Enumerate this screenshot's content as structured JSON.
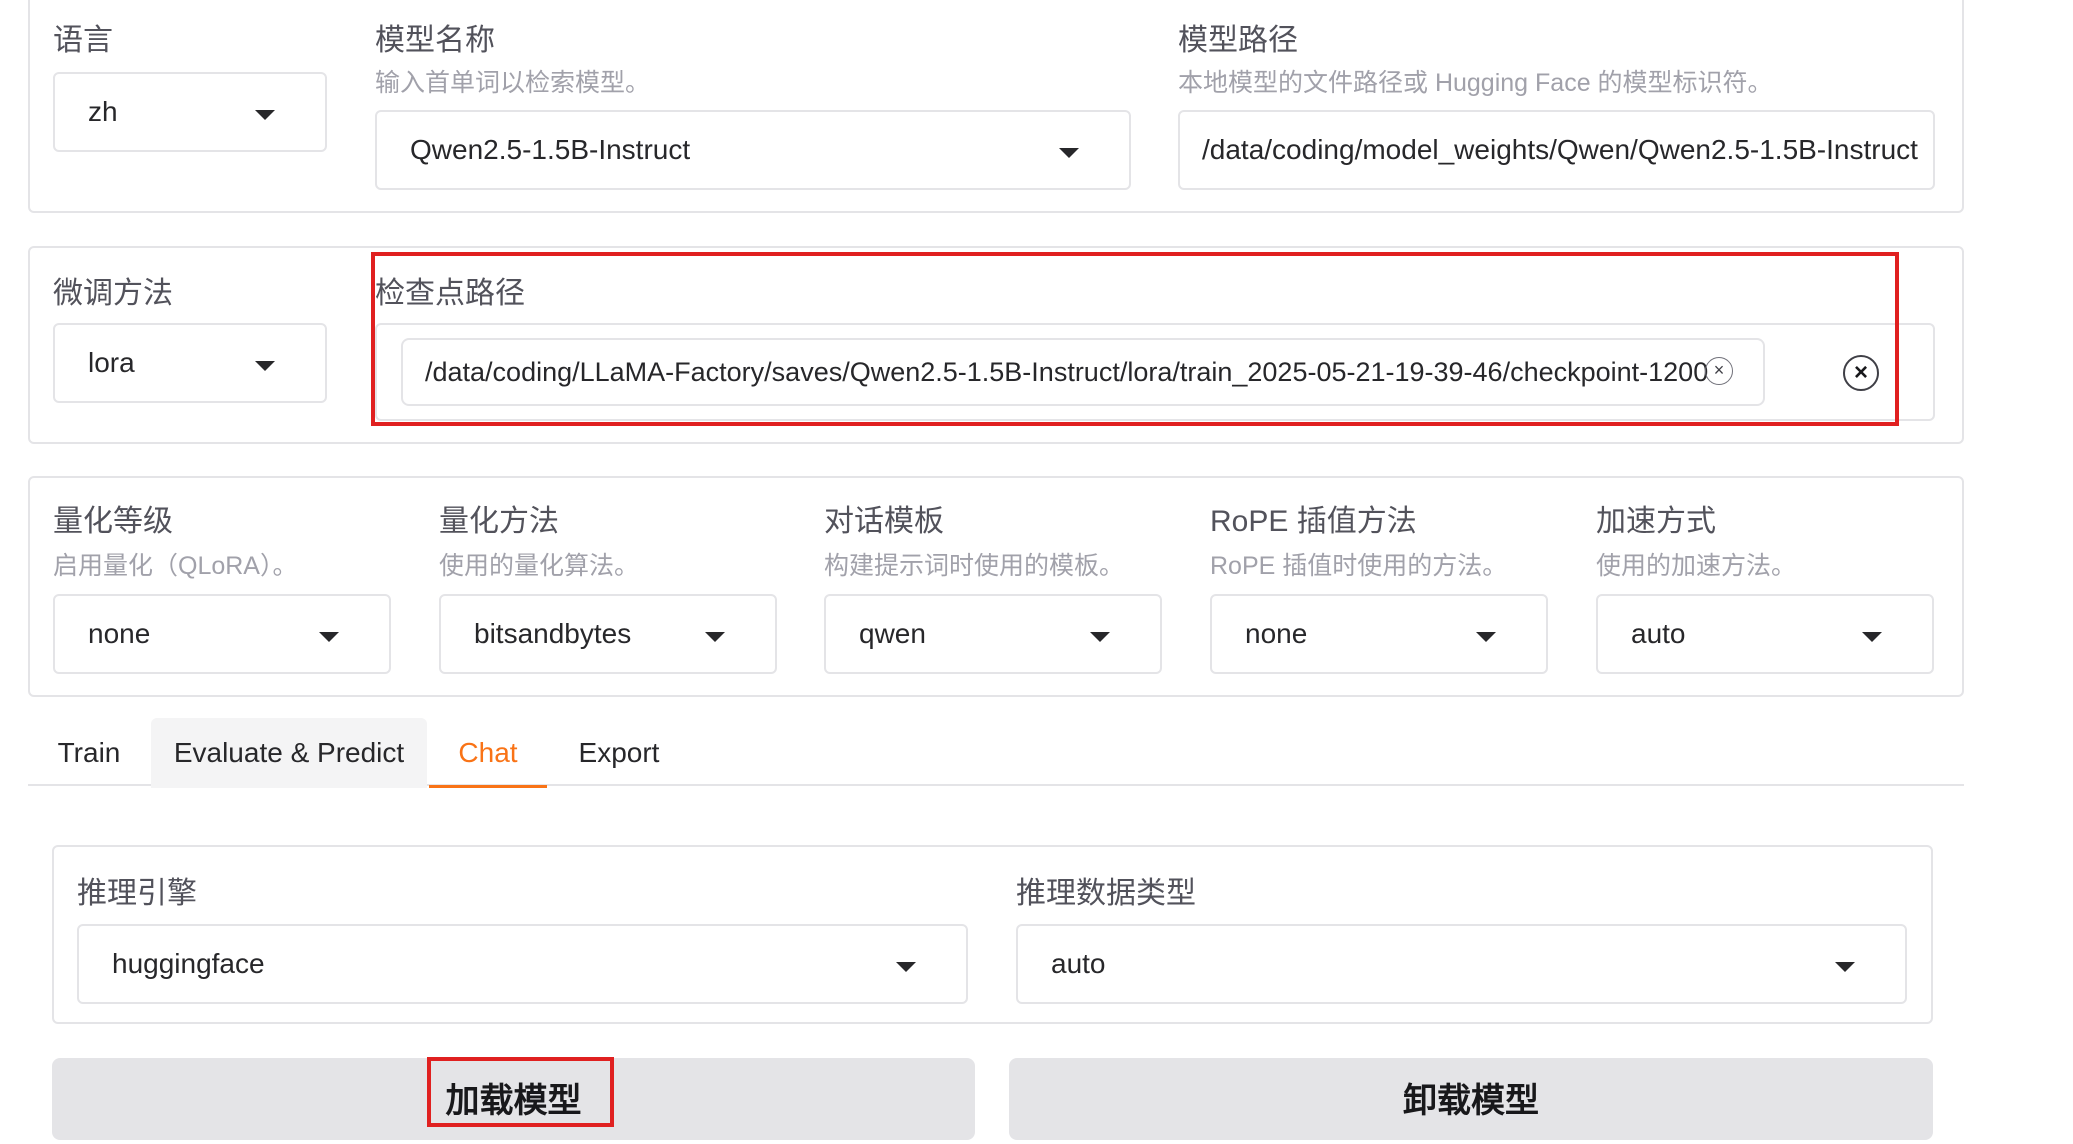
{
  "model_row": {
    "language": {
      "label": "语言",
      "value": "zh"
    },
    "model_name": {
      "label": "模型名称",
      "info": "输入首单词以检索模型。",
      "value": "Qwen2.5-1.5B-Instruct"
    },
    "model_path": {
      "label": "模型路径",
      "info": "本地模型的文件路径或 Hugging Face 的模型标识符。",
      "value": "/data/coding/model_weights/Qwen/Qwen2.5-1.5B-Instruct"
    }
  },
  "finetune_row": {
    "method": {
      "label": "微调方法",
      "value": "lora"
    },
    "checkpoint": {
      "label": "检查点路径",
      "value": "/data/coding/LLaMA-Factory/saves/Qwen2.5-1.5B-Instruct/lora/train_2025-05-21-19-39-46/checkpoint-1200",
      "remove_icon": "×",
      "clear_icon": "×"
    }
  },
  "advanced_row": [
    {
      "label": "量化等级",
      "info": "启用量化（QLoRA）。",
      "value": "none"
    },
    {
      "label": "量化方法",
      "info": "使用的量化算法。",
      "value": "bitsandbytes"
    },
    {
      "label": "对话模板",
      "info": "构建提示词时使用的模板。",
      "value": "qwen"
    },
    {
      "label": "RoPE 插值方法",
      "info": "RoPE 插值时使用的方法。",
      "value": "none"
    },
    {
      "label": "加速方式",
      "info": "使用的加速方法。",
      "value": "auto"
    }
  ],
  "tabs": [
    {
      "label": "Train"
    },
    {
      "label": "Evaluate & Predict"
    },
    {
      "label": "Chat",
      "active": true
    },
    {
      "label": "Export"
    }
  ],
  "chat_panel": {
    "infer_backend": {
      "label": "推理引擎",
      "value": "huggingface"
    },
    "infer_dtype": {
      "label": "推理数据类型",
      "value": "auto"
    }
  },
  "buttons": {
    "load": "加载模型",
    "unload": "卸载模型"
  },
  "colors": {
    "accent": "#f97316",
    "highlight": "#e02020",
    "border": "#e4e4e7",
    "button_bg": "#e4e4e7"
  }
}
